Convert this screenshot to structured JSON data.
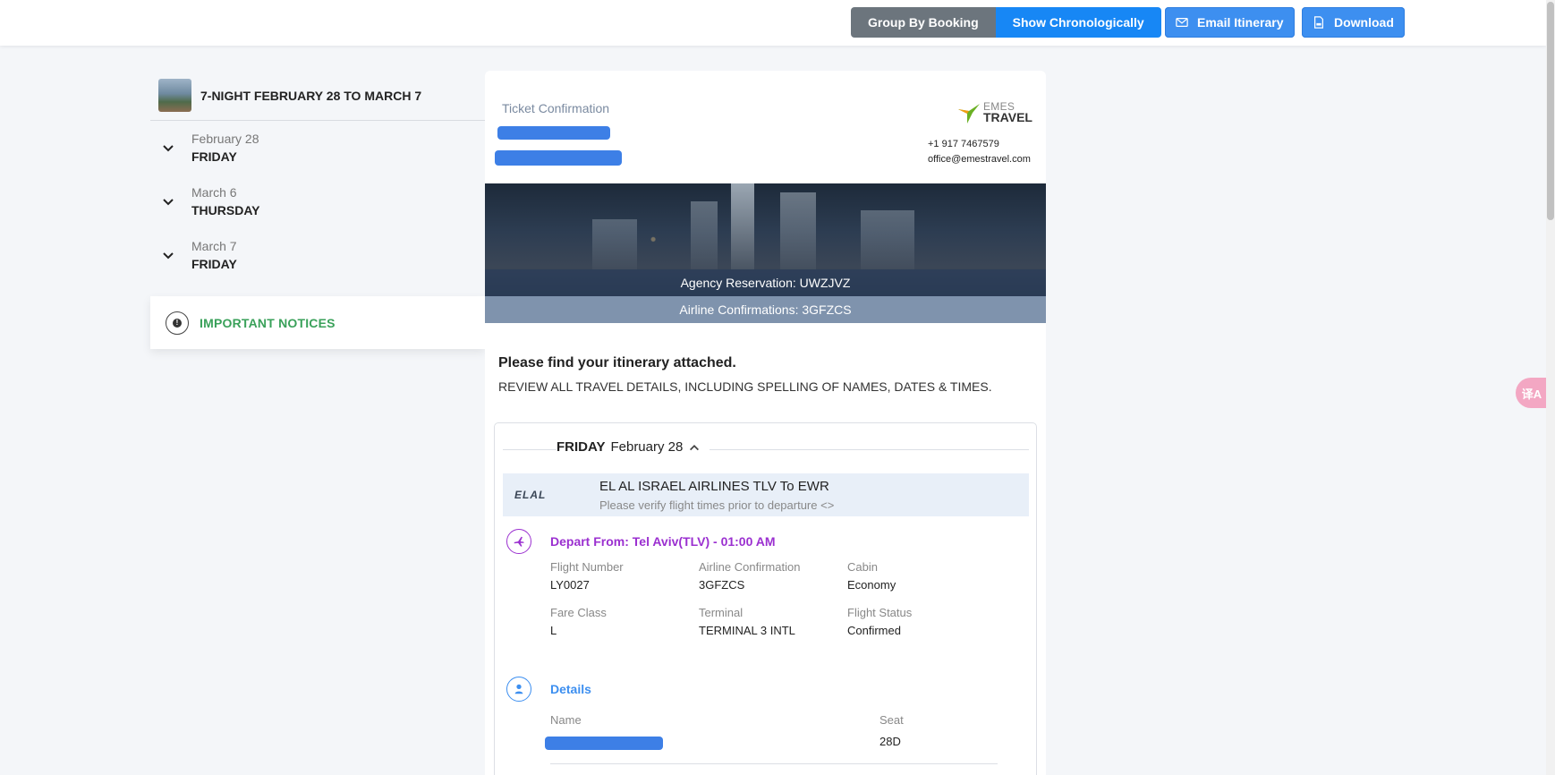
{
  "toolbar": {
    "group_by_booking": "Group By Booking",
    "show_chronologically": "Show Chronologically",
    "email_itinerary": "Email Itinerary",
    "download": "Download"
  },
  "sidebar": {
    "trip_title": "7-NIGHT FEBRUARY 28 TO MARCH 7",
    "days": [
      {
        "date": "February 28",
        "weekday": "FRIDAY"
      },
      {
        "date": "March 6",
        "weekday": "THURSDAY"
      },
      {
        "date": "March 7",
        "weekday": "FRIDAY"
      }
    ],
    "notices_label": "IMPORTANT NOTICES"
  },
  "translate_fab": "译A",
  "card": {
    "ticket_label": "Ticket Confirmation",
    "logo_line1": "EMES",
    "logo_line2": "TRAVEL",
    "phone": "+1 917 7467579",
    "email": "office@emestravel.com",
    "agency_reservation": "Agency Reservation: UWZJVZ",
    "airline_confirmations": "Airline Confirmations: 3GFZCS",
    "intro_title": "Please find your itinerary attached.",
    "intro_sub": "REVIEW ALL TRAVEL DETAILS, INCLUDING SPELLING OF NAMES, DATES & TIMES."
  },
  "day_panel": {
    "weekday": "FRIDAY",
    "date": "February 28",
    "airline_logo_text": "ELAL",
    "airline_title": "EL AL ISRAEL AIRLINES TLV To EWR",
    "airline_note": "Please verify flight times prior to departure <>",
    "depart_title": "Depart From: Tel Aviv(TLV) - 01:00 AM",
    "fields": [
      {
        "label": "Flight Number",
        "value": "LY0027"
      },
      {
        "label": "Airline Confirmation",
        "value": "3GFZCS"
      },
      {
        "label": "Cabin",
        "value": "Economy"
      },
      {
        "label": "Fare Class",
        "value": "L"
      },
      {
        "label": "Terminal",
        "value": "TERMINAL 3 INTL"
      },
      {
        "label": "Flight Status",
        "value": "Confirmed"
      }
    ],
    "details_title": "Details",
    "name_label": "Name",
    "seat_label": "Seat",
    "seat_value": "28D"
  },
  "colors": {
    "accent_blue": "#1787f5",
    "grey_button": "#6c757d",
    "notice_green": "#3aa15a",
    "depart_purple": "#9b30d0",
    "details_blue": "#3d8ff0",
    "redaction": "#3d7fe6"
  }
}
